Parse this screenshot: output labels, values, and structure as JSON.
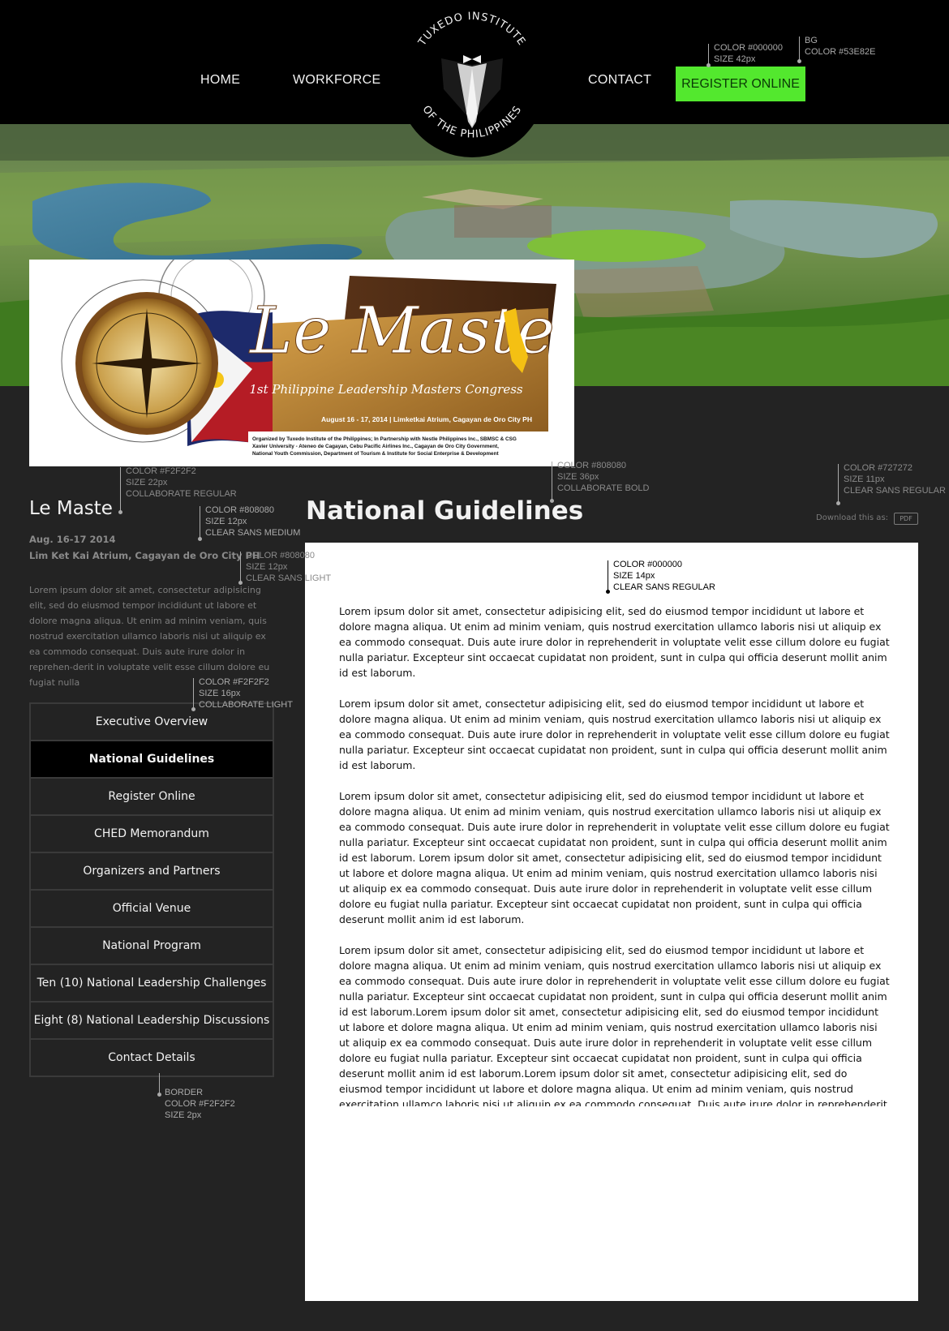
{
  "header": {
    "nav": {
      "home": "HOME",
      "workforce": "WORKFORCE",
      "contact": "CONTACT",
      "register": "REGISTER ONLINE"
    },
    "logo": {
      "top_text": "TUXEDO INSTITUTE",
      "bottom_text": "OF THE PHILIPPINES"
    }
  },
  "banner": {
    "title": "Le Maste",
    "subtitle": "1st Philippine Leadership Masters Congress",
    "date_venue": "August 16 - 17, 2014 | Limketkai Atrium, Cagayan de Oro City PH",
    "organized_by": "Organized by Tuxedo Institute of the Philippines; In Partnership with Nestle Philippines Inc., SBMSC & CSG",
    "organized_by_2": "Xavier University - Ateneo de Cagayan, Cebu Pacific Airlines Inc., Cagayan de Oro City Government,",
    "organized_by_3": "National Youth Commission, Department of Tourism & Institute for Social Enterprise & Development"
  },
  "sidebar": {
    "event_title": "Le Maste",
    "date": "Aug. 16-17 2014",
    "venue": "Lim Ket Kai Atrium, Cagayan de Oro City PH",
    "description": "Lorem ipsum dolor sit amet, consectetur adipisicing elit, sed do eiusmod tempor incididunt ut labore et dolore magna aliqua. Ut enim ad minim veniam, quis nostrud exercitation ullamco laboris nisi ut aliquip ex ea commodo consequat. Duis aute irure dolor in reprehen-derit in voluptate velit esse cillum dolore eu fugiat nulla",
    "menu": [
      "Executive Overview",
      "National Guidelines",
      "Register Online",
      "CHED Memorandum",
      "Organizers and Partners",
      "Official Venue",
      "National Program",
      "Ten (10) National Leadership Challenges",
      "Eight (8) National Leadership Discussions",
      "Contact Details"
    ]
  },
  "main": {
    "title": "National Guidelines",
    "download_label": "Download this as:",
    "download_button": "PDF",
    "paragraphs": [
      "Lorem ipsum dolor sit amet, consectetur adipisicing elit, sed do eiusmod tempor incididunt ut labore et dolore magna aliqua. Ut enim ad minim veniam, quis nostrud exercitation ullamco laboris nisi ut aliquip ex ea commodo consequat. Duis aute irure dolor in reprehenderit in voluptate velit esse cillum dolore eu fugiat nulla pariatur. Excepteur sint occaecat cupidatat non proident, sunt in culpa qui officia deserunt mollit anim id est laborum.",
      "Lorem ipsum dolor sit amet, consectetur adipisicing elit, sed do eiusmod tempor incididunt ut labore et dolore magna aliqua. Ut enim ad minim veniam, quis nostrud exercitation ullamco laboris nisi ut aliquip ex ea commodo consequat. Duis aute irure dolor in reprehenderit in voluptate velit esse cillum dolore eu fugiat nulla pariatur. Excepteur sint occaecat cupidatat non proident, sunt in culpa qui officia deserunt mollit anim id est laborum.",
      "Lorem ipsum dolor sit amet, consectetur adipisicing elit, sed do eiusmod tempor incididunt ut labore et dolore magna aliqua. Ut enim ad minim veniam, quis nostrud exercitation ullamco laboris nisi ut aliquip ex ea commodo consequat. Duis aute irure dolor in reprehenderit in voluptate velit esse cillum dolore eu fugiat nulla pariatur. Excepteur sint occaecat cupidatat non proident, sunt in culpa qui officia deserunt mollit anim id est laborum. Lorem ipsum dolor sit amet, consectetur adipisicing elit, sed do eiusmod tempor incididunt ut labore et dolore magna aliqua. Ut enim ad minim veniam, quis nostrud exercitation ullamco laboris nisi ut aliquip ex ea commodo consequat. Duis aute irure dolor in reprehenderit in voluptate velit esse cillum dolore eu fugiat nulla pariatur. Excepteur sint occaecat cupidatat non proident, sunt in culpa qui officia deserunt mollit anim id est laborum.",
      "Lorem ipsum dolor sit amet, consectetur adipisicing elit, sed do eiusmod tempor incididunt ut labore et dolore magna aliqua. Ut enim ad minim veniam, quis nostrud exercitation ullamco laboris nisi ut aliquip ex ea commodo consequat. Duis aute irure dolor in reprehenderit in voluptate velit esse cillum dolore eu fugiat nulla pariatur. Excepteur sint occaecat cupidatat non proident, sunt in culpa qui officia deserunt mollit anim id est laborum.Lorem ipsum dolor sit amet, consectetur adipisicing elit, sed do eiusmod tempor incididunt ut labore et dolore magna aliqua. Ut enim ad minim veniam, quis nostrud exercitation ullamco laboris nisi ut aliquip ex ea commodo consequat. Duis aute irure dolor in reprehenderit in voluptate velit esse cillum dolore eu fugiat nulla pariatur. Excepteur sint occaecat cupidatat non proident, sunt in culpa qui officia deserunt mollit anim id est laborum.Lorem ipsum dolor sit amet, consectetur adipisicing elit, sed do eiusmod tempor incididunt ut labore et dolore magna aliqua. Ut enim ad minim veniam, quis nostrud exercitation ullamco laboris nisi ut aliquip ex ea commodo consequat. Duis aute irure dolor in reprehenderit in voluptate velit esse"
    ]
  },
  "annotations": {
    "register": {
      "line1": "COLOR #000000",
      "line2": "SIZE 42px"
    },
    "register_bg": {
      "line1": "BG",
      "line2": "COLOR #53E82E"
    },
    "event_title": {
      "line1": "COLOR #F2F2F2",
      "line2": "SIZE 22px",
      "line3": "COLLABORATE REGULAR"
    },
    "event_date": {
      "line1": "COLOR #808080",
      "line2": "SIZE 12px",
      "line3": "CLEAR SANS MEDIUM"
    },
    "event_desc": {
      "line1": "COLOR #808080",
      "line2": "SIZE 12px",
      "line3": "CLEAR SANS LIGHT"
    },
    "menu": {
      "line1": "COLOR #F2F2F2",
      "line2": "SIZE 16px",
      "line3": "COLLABORATE LIGHT"
    },
    "menu_border": {
      "line1": "BORDER",
      "line2": "COLOR #F2F2F2",
      "line3": "SIZE 2px"
    },
    "page_title": {
      "line1": "COLOR #808080",
      "line2": "SIZE 36px",
      "line3": "COLLABORATE BOLD"
    },
    "download": {
      "line1": "COLOR #727272",
      "line2": "SIZE 11px",
      "line3": "CLEAR SANS REGULAR"
    },
    "body_text": {
      "line1": "COLOR #000000",
      "line2": "SIZE 14px",
      "line3": "CLEAR SANS REGULAR"
    }
  },
  "colors": {
    "header_bg": "#000000",
    "page_bg": "#232323",
    "accent": "#53E82E",
    "menu_border": "#3a3a3a"
  }
}
